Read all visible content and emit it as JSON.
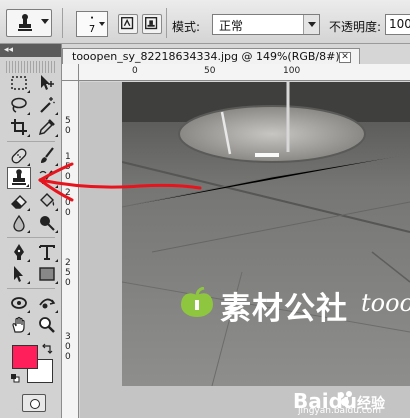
{
  "options_bar": {
    "brush_size": "7",
    "mode_label": "模式:",
    "mode_value": "正常",
    "opacity_label": "不透明度:",
    "opacity_value": "100"
  },
  "toolbox": {
    "collapse_glyph": "◂◂",
    "foreground_color": "#ff1f5a",
    "background_color": "#ffffff",
    "tools": [
      "move-tool",
      "marquee-tool",
      "lasso-tool",
      "magic-wand-tool",
      "crop-tool",
      "eyedropper-tool",
      "healing-brush-tool",
      "brush-tool",
      "clone-stamp-tool",
      "history-brush-tool",
      "eraser-tool",
      "paint-bucket-tool",
      "blur-tool",
      "dodge-tool",
      "pen-tool",
      "type-tool",
      "path-selection-tool",
      "shape-tool",
      "3d-rotate-tool",
      "3d-orbit-tool",
      "hand-tool",
      "zoom-tool"
    ],
    "active_tool": "clone-stamp-tool"
  },
  "document": {
    "tab_title": "tooopen_sy_82218634334.jpg @ 149%(RGB/8#)",
    "close_glyph": "✕",
    "ruler_h": [
      "0",
      "50",
      "100"
    ],
    "ruler_v": [
      "5",
      "0",
      "1",
      "5",
      "0",
      "2",
      "0",
      "0",
      "2",
      "5",
      "0",
      "3",
      "0",
      "0"
    ]
  },
  "watermark": {
    "cn_text": "素材公社",
    "latin_text": "tooo",
    "logo_color": "#8ec63f"
  },
  "baidu_watermark": {
    "text": "Baidu",
    "jingyan": "经验",
    "url": "jingyan.baidu.com"
  },
  "annotation": {
    "arrow_color": "#e8141d"
  }
}
